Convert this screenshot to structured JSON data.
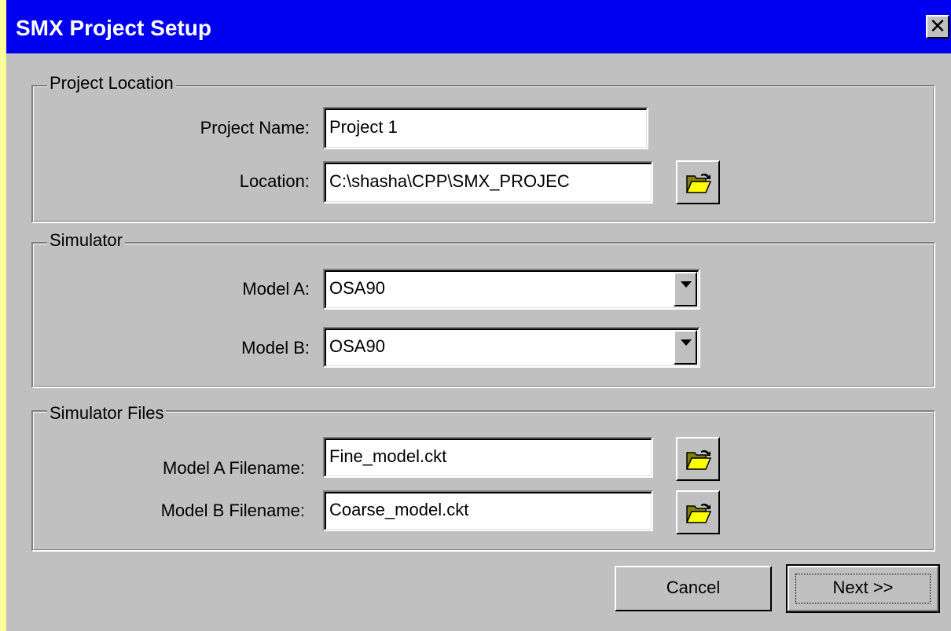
{
  "window": {
    "title": "SMX Project Setup",
    "close_glyph": "✕"
  },
  "project_location": {
    "legend": "Project Location",
    "name_label": "Project Name:",
    "name_value": "Project 1",
    "location_label": "Location:",
    "location_value": "C:\\shasha\\CPP\\SMX_PROJEC",
    "browse_icon": "folder-open-icon"
  },
  "simulator": {
    "legend": "Simulator",
    "model_a_label": "Model A:",
    "model_a_value": "OSA90",
    "model_b_label": "Model B:",
    "model_b_value": "OSA90"
  },
  "simulator_files": {
    "legend": "Simulator Files",
    "model_a_filename_label": "Model A Filename:",
    "model_a_filename_value": "Fine_model.ckt",
    "model_b_filename_label": "Model B Filename:",
    "model_b_filename_value": "Coarse_model.ckt"
  },
  "buttons": {
    "cancel": "Cancel",
    "next": "Next >>"
  },
  "colors": {
    "titlebar": "#0000f0",
    "face": "#c0c0c0",
    "desktop": "#ffff99"
  }
}
